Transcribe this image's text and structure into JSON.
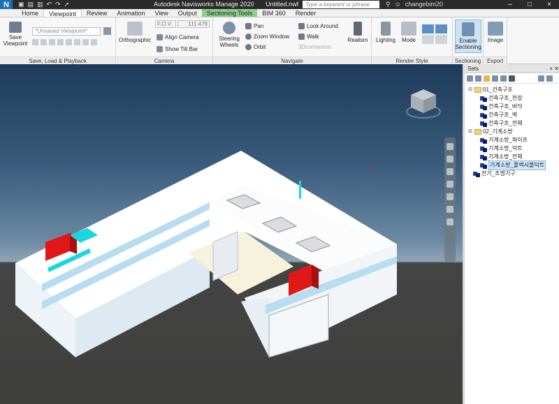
{
  "titlebar": {
    "app_letter": "N",
    "app_name": "Autodesk Navisworks Manage 2020",
    "file_name": "Untitled.nwf",
    "search_placeholder": "Type a keyword or phrase",
    "user": "changebim20",
    "minimize": "–",
    "maximize": "□",
    "close": "×"
  },
  "tabs": [
    {
      "label": "Home"
    },
    {
      "label": "Viewpoint"
    },
    {
      "label": "Review"
    },
    {
      "label": "Animation"
    },
    {
      "label": "View"
    },
    {
      "label": "Output"
    },
    {
      "label": "Sectioning Tools"
    },
    {
      "label": "BIM 360"
    },
    {
      "label": "Render"
    }
  ],
  "ribbon": {
    "save_load": {
      "save_viewpoint": "Save Viewpoint",
      "viewpoint_dropdown": "*Unsaved Viewpoint*",
      "group_label": "Save, Load & Playback"
    },
    "camera": {
      "orthographic": "Orthographic",
      "fov_label": "F.O.V.",
      "fov_value": "111.479",
      "align_camera": "Align Camera",
      "show_tilt_bar": "Show Tilt Bar",
      "group_label": "Camera"
    },
    "navigate": {
      "steering_wheels": "Steering Wheels",
      "pan": "Pan",
      "zoom_window": "Zoom Window",
      "orbit": "Orbit",
      "look_around": "Look Around",
      "walk": "Walk",
      "connexion": "3Dconnexion",
      "realism": "Realism",
      "group_label": "Navigate"
    },
    "render_style": {
      "lighting": "Lighting",
      "mode": "Mode",
      "group_label": "Render Style"
    },
    "sectioning": {
      "enable": "Enable Sectioning",
      "group_label": "Sectioning"
    },
    "export": {
      "image": "Image",
      "group_label": "Export"
    }
  },
  "sets_panel": {
    "title": "Sets",
    "tree": [
      {
        "label": "01_건축구조",
        "type": "folder",
        "indent": 0
      },
      {
        "label": "건축구조_천장",
        "type": "set",
        "indent": 1
      },
      {
        "label": "건축구조_바닥",
        "type": "set",
        "indent": 1
      },
      {
        "label": "건축구조_벽",
        "type": "set",
        "indent": 1
      },
      {
        "label": "건축구조_전체",
        "type": "set",
        "indent": 1
      },
      {
        "label": "02_기계소방",
        "type": "folder",
        "indent": 0
      },
      {
        "label": "기계소방_파이프",
        "type": "set",
        "indent": 1
      },
      {
        "label": "기계소방_덕트",
        "type": "set",
        "indent": 1
      },
      {
        "label": "기계소방_전체",
        "type": "set",
        "indent": 1
      },
      {
        "label": "기계소방_플렉시블덕트",
        "type": "set",
        "indent": 1,
        "selected": true
      },
      {
        "label": "전기_조명기구",
        "type": "set",
        "indent": 0
      }
    ]
  },
  "colors": {
    "accent": "#1572b6",
    "section_tab": "#8fcf8a",
    "model_white": "#ffffff",
    "duct_red": "#e01818",
    "duct_cyan": "#19d7e0"
  }
}
